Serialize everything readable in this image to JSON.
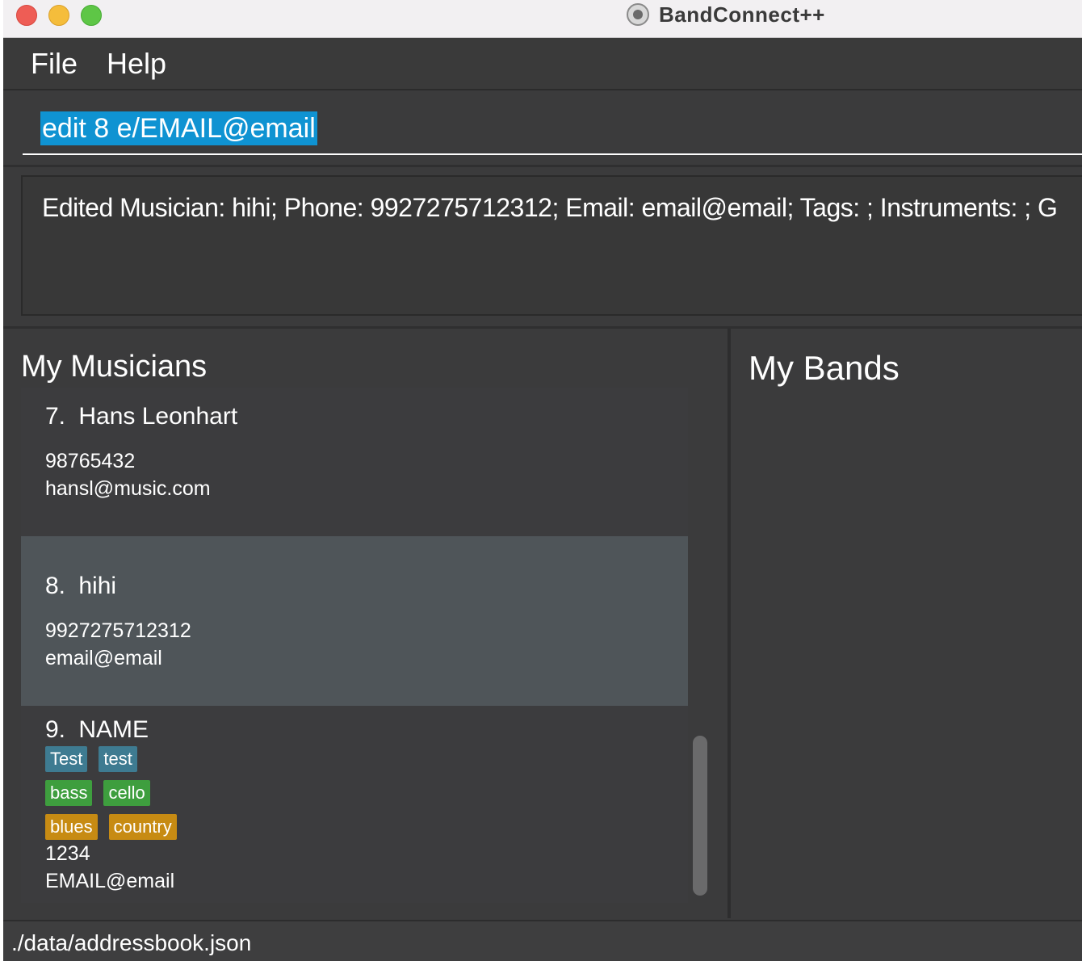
{
  "window": {
    "title": "BandConnect++"
  },
  "menu": {
    "file": "File",
    "help": "Help"
  },
  "command": {
    "value": "edit 8 e/EMAIL@email"
  },
  "result": {
    "text": "Edited Musician: hihi; Phone: 9927275712312; Email: email@email; Tags: ; Instruments: ; G"
  },
  "musicians": {
    "title": "My Musicians",
    "items": [
      {
        "index": "7.",
        "name": "Hans Leonhart",
        "phone": "98765432",
        "email": "hansl@music.com",
        "selected": false
      },
      {
        "index": "8.",
        "name": "hihi",
        "phone": "9927275712312",
        "email": "email@email",
        "selected": true
      },
      {
        "index": "9.",
        "name": "NAME",
        "tags": [
          "Test",
          "test"
        ],
        "instruments": [
          "bass",
          "cello"
        ],
        "genres": [
          "blues",
          "country"
        ],
        "phone": "1234",
        "email": "EMAIL@email",
        "selected": false
      }
    ]
  },
  "bands": {
    "title": "My Bands"
  },
  "status": {
    "path": "./data/addressbook.json"
  },
  "colors": {
    "tag": "#3e7b91",
    "instrument": "#3e9e3e",
    "genre": "#c78b13",
    "selection_highlight": "#0f93d2",
    "background": "#3b3b3c"
  }
}
